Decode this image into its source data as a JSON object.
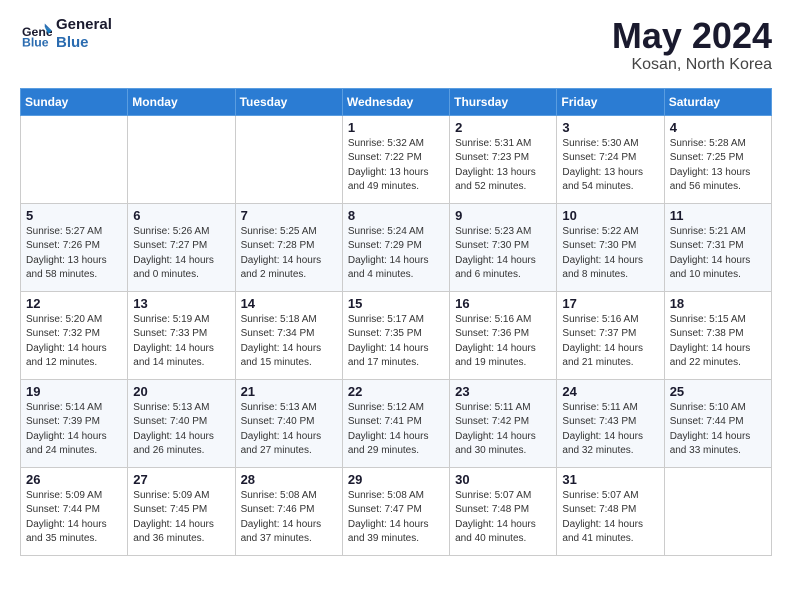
{
  "header": {
    "logo_line1": "General",
    "logo_line2": "Blue",
    "month_title": "May 2024",
    "location": "Kosan, North Korea"
  },
  "days_of_week": [
    "Sunday",
    "Monday",
    "Tuesday",
    "Wednesday",
    "Thursday",
    "Friday",
    "Saturday"
  ],
  "weeks": [
    [
      {
        "day": "",
        "sunrise": "",
        "sunset": "",
        "daylight": ""
      },
      {
        "day": "",
        "sunrise": "",
        "sunset": "",
        "daylight": ""
      },
      {
        "day": "",
        "sunrise": "",
        "sunset": "",
        "daylight": ""
      },
      {
        "day": "1",
        "sunrise": "Sunrise: 5:32 AM",
        "sunset": "Sunset: 7:22 PM",
        "daylight": "Daylight: 13 hours and 49 minutes."
      },
      {
        "day": "2",
        "sunrise": "Sunrise: 5:31 AM",
        "sunset": "Sunset: 7:23 PM",
        "daylight": "Daylight: 13 hours and 52 minutes."
      },
      {
        "day": "3",
        "sunrise": "Sunrise: 5:30 AM",
        "sunset": "Sunset: 7:24 PM",
        "daylight": "Daylight: 13 hours and 54 minutes."
      },
      {
        "day": "4",
        "sunrise": "Sunrise: 5:28 AM",
        "sunset": "Sunset: 7:25 PM",
        "daylight": "Daylight: 13 hours and 56 minutes."
      }
    ],
    [
      {
        "day": "5",
        "sunrise": "Sunrise: 5:27 AM",
        "sunset": "Sunset: 7:26 PM",
        "daylight": "Daylight: 13 hours and 58 minutes."
      },
      {
        "day": "6",
        "sunrise": "Sunrise: 5:26 AM",
        "sunset": "Sunset: 7:27 PM",
        "daylight": "Daylight: 14 hours and 0 minutes."
      },
      {
        "day": "7",
        "sunrise": "Sunrise: 5:25 AM",
        "sunset": "Sunset: 7:28 PM",
        "daylight": "Daylight: 14 hours and 2 minutes."
      },
      {
        "day": "8",
        "sunrise": "Sunrise: 5:24 AM",
        "sunset": "Sunset: 7:29 PM",
        "daylight": "Daylight: 14 hours and 4 minutes."
      },
      {
        "day": "9",
        "sunrise": "Sunrise: 5:23 AM",
        "sunset": "Sunset: 7:30 PM",
        "daylight": "Daylight: 14 hours and 6 minutes."
      },
      {
        "day": "10",
        "sunrise": "Sunrise: 5:22 AM",
        "sunset": "Sunset: 7:30 PM",
        "daylight": "Daylight: 14 hours and 8 minutes."
      },
      {
        "day": "11",
        "sunrise": "Sunrise: 5:21 AM",
        "sunset": "Sunset: 7:31 PM",
        "daylight": "Daylight: 14 hours and 10 minutes."
      }
    ],
    [
      {
        "day": "12",
        "sunrise": "Sunrise: 5:20 AM",
        "sunset": "Sunset: 7:32 PM",
        "daylight": "Daylight: 14 hours and 12 minutes."
      },
      {
        "day": "13",
        "sunrise": "Sunrise: 5:19 AM",
        "sunset": "Sunset: 7:33 PM",
        "daylight": "Daylight: 14 hours and 14 minutes."
      },
      {
        "day": "14",
        "sunrise": "Sunrise: 5:18 AM",
        "sunset": "Sunset: 7:34 PM",
        "daylight": "Daylight: 14 hours and 15 minutes."
      },
      {
        "day": "15",
        "sunrise": "Sunrise: 5:17 AM",
        "sunset": "Sunset: 7:35 PM",
        "daylight": "Daylight: 14 hours and 17 minutes."
      },
      {
        "day": "16",
        "sunrise": "Sunrise: 5:16 AM",
        "sunset": "Sunset: 7:36 PM",
        "daylight": "Daylight: 14 hours and 19 minutes."
      },
      {
        "day": "17",
        "sunrise": "Sunrise: 5:16 AM",
        "sunset": "Sunset: 7:37 PM",
        "daylight": "Daylight: 14 hours and 21 minutes."
      },
      {
        "day": "18",
        "sunrise": "Sunrise: 5:15 AM",
        "sunset": "Sunset: 7:38 PM",
        "daylight": "Daylight: 14 hours and 22 minutes."
      }
    ],
    [
      {
        "day": "19",
        "sunrise": "Sunrise: 5:14 AM",
        "sunset": "Sunset: 7:39 PM",
        "daylight": "Daylight: 14 hours and 24 minutes."
      },
      {
        "day": "20",
        "sunrise": "Sunrise: 5:13 AM",
        "sunset": "Sunset: 7:40 PM",
        "daylight": "Daylight: 14 hours and 26 minutes."
      },
      {
        "day": "21",
        "sunrise": "Sunrise: 5:13 AM",
        "sunset": "Sunset: 7:40 PM",
        "daylight": "Daylight: 14 hours and 27 minutes."
      },
      {
        "day": "22",
        "sunrise": "Sunrise: 5:12 AM",
        "sunset": "Sunset: 7:41 PM",
        "daylight": "Daylight: 14 hours and 29 minutes."
      },
      {
        "day": "23",
        "sunrise": "Sunrise: 5:11 AM",
        "sunset": "Sunset: 7:42 PM",
        "daylight": "Daylight: 14 hours and 30 minutes."
      },
      {
        "day": "24",
        "sunrise": "Sunrise: 5:11 AM",
        "sunset": "Sunset: 7:43 PM",
        "daylight": "Daylight: 14 hours and 32 minutes."
      },
      {
        "day": "25",
        "sunrise": "Sunrise: 5:10 AM",
        "sunset": "Sunset: 7:44 PM",
        "daylight": "Daylight: 14 hours and 33 minutes."
      }
    ],
    [
      {
        "day": "26",
        "sunrise": "Sunrise: 5:09 AM",
        "sunset": "Sunset: 7:44 PM",
        "daylight": "Daylight: 14 hours and 35 minutes."
      },
      {
        "day": "27",
        "sunrise": "Sunrise: 5:09 AM",
        "sunset": "Sunset: 7:45 PM",
        "daylight": "Daylight: 14 hours and 36 minutes."
      },
      {
        "day": "28",
        "sunrise": "Sunrise: 5:08 AM",
        "sunset": "Sunset: 7:46 PM",
        "daylight": "Daylight: 14 hours and 37 minutes."
      },
      {
        "day": "29",
        "sunrise": "Sunrise: 5:08 AM",
        "sunset": "Sunset: 7:47 PM",
        "daylight": "Daylight: 14 hours and 39 minutes."
      },
      {
        "day": "30",
        "sunrise": "Sunrise: 5:07 AM",
        "sunset": "Sunset: 7:48 PM",
        "daylight": "Daylight: 14 hours and 40 minutes."
      },
      {
        "day": "31",
        "sunrise": "Sunrise: 5:07 AM",
        "sunset": "Sunset: 7:48 PM",
        "daylight": "Daylight: 14 hours and 41 minutes."
      },
      {
        "day": "",
        "sunrise": "",
        "sunset": "",
        "daylight": ""
      }
    ]
  ]
}
